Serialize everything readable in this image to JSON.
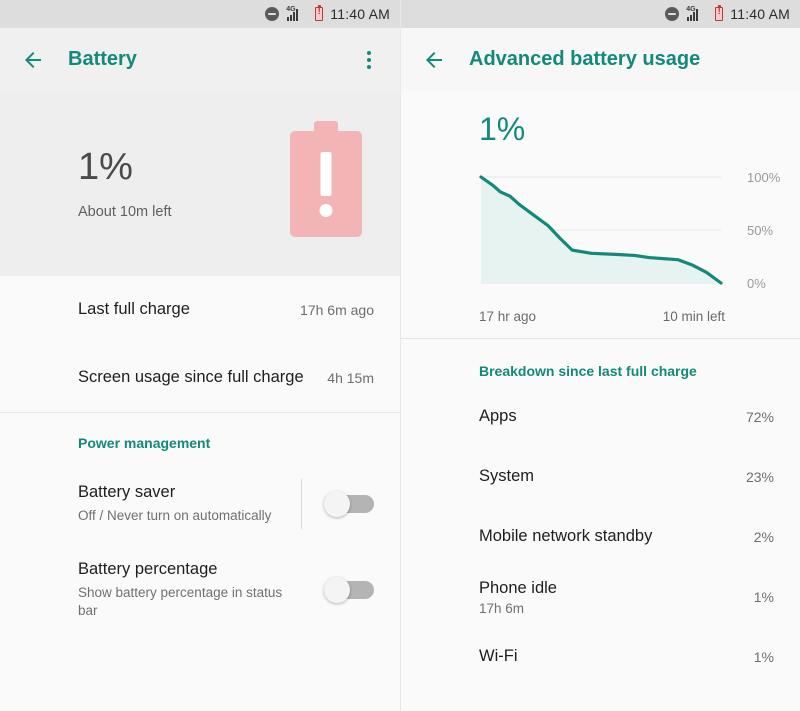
{
  "status_bar": {
    "dnd_icon": "do-not-disturb-icon",
    "signal_label": "4G",
    "signal_icon": "signal-bars-icon",
    "battery_icon": "battery-alert-icon",
    "time": "11:40 AM"
  },
  "left_screen": {
    "back_icon": "back-arrow-icon",
    "title": "Battery",
    "overflow_icon": "overflow-menu-icon",
    "hero": {
      "percent": "1%",
      "subtitle": "About 10m left",
      "battery_icon": "battery-alert-large-icon",
      "battery_color": "#f2b4b4"
    },
    "rows": [
      {
        "title": "Last full charge",
        "value": "17h 6m ago"
      },
      {
        "title": "Screen usage since full charge",
        "value": "4h 15m"
      }
    ],
    "power_management": {
      "header": "Power management",
      "items": [
        {
          "title": "Battery saver",
          "subtitle": "Off / Never turn on automatically",
          "toggle_state": "off"
        },
        {
          "title": "Battery percentage",
          "subtitle": "Show battery percentage in status bar",
          "toggle_state": "off"
        }
      ]
    }
  },
  "right_screen": {
    "back_icon": "back-arrow-icon",
    "title": "Advanced battery usage",
    "percent": "1%",
    "breakdown_header": "Breakdown since last full charge",
    "rows": [
      {
        "title": "Apps",
        "subtitle": "",
        "value": "72%"
      },
      {
        "title": "System",
        "subtitle": "",
        "value": "23%"
      },
      {
        "title": "Mobile network standby",
        "subtitle": "",
        "value": "2%"
      },
      {
        "title": "Phone idle",
        "subtitle": "17h 6m",
        "value": "1%"
      },
      {
        "title": "Wi-Fi",
        "subtitle": "",
        "value": "1%"
      }
    ]
  },
  "accent_color": "#12897a",
  "chart_data": {
    "type": "area",
    "title": "Battery level history",
    "xlabel": "",
    "ylabel": "",
    "x_tick_labels": [
      "17 hr ago",
      "10 min left"
    ],
    "y_tick_labels": [
      "100%",
      "50%",
      "0%"
    ],
    "ylim": [
      0,
      100
    ],
    "grid": true,
    "legend": "none",
    "line_color": "#12897a",
    "fill_color": "#e3f1ee",
    "x": [
      0,
      5,
      8,
      12,
      16,
      22,
      28,
      33,
      38,
      46,
      56,
      64,
      70,
      76,
      82,
      88,
      94,
      100
    ],
    "values": [
      100,
      92,
      86,
      82,
      74,
      64,
      54,
      42,
      31,
      28,
      27,
      26,
      24,
      23,
      22,
      17,
      10,
      0
    ]
  }
}
